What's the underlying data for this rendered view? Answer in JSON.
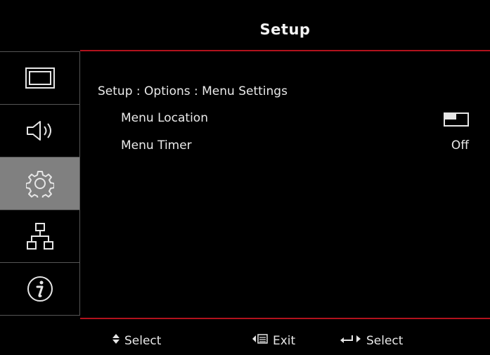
{
  "header": {
    "title": "Setup"
  },
  "sidebar": {
    "tabs": [
      {
        "name": "display-tab",
        "icon": "display-icon",
        "active": false
      },
      {
        "name": "audio-tab",
        "icon": "speaker-icon",
        "active": false
      },
      {
        "name": "setup-tab",
        "icon": "gear-icon",
        "active": true
      },
      {
        "name": "network-tab",
        "icon": "network-icon",
        "active": false
      },
      {
        "name": "info-tab",
        "icon": "info-icon",
        "active": false
      }
    ]
  },
  "main": {
    "breadcrumb": "Setup : Options : Menu Settings",
    "rows": [
      {
        "label": "Menu Location",
        "value_icon": "menu-location-icon"
      },
      {
        "label": "Menu Timer",
        "value": "Off"
      }
    ]
  },
  "footer": {
    "select_label": "Select",
    "exit_label": "Exit",
    "enter_label": "Select"
  },
  "colors": {
    "accent": "#b1121d",
    "active_tab": "#808080"
  }
}
